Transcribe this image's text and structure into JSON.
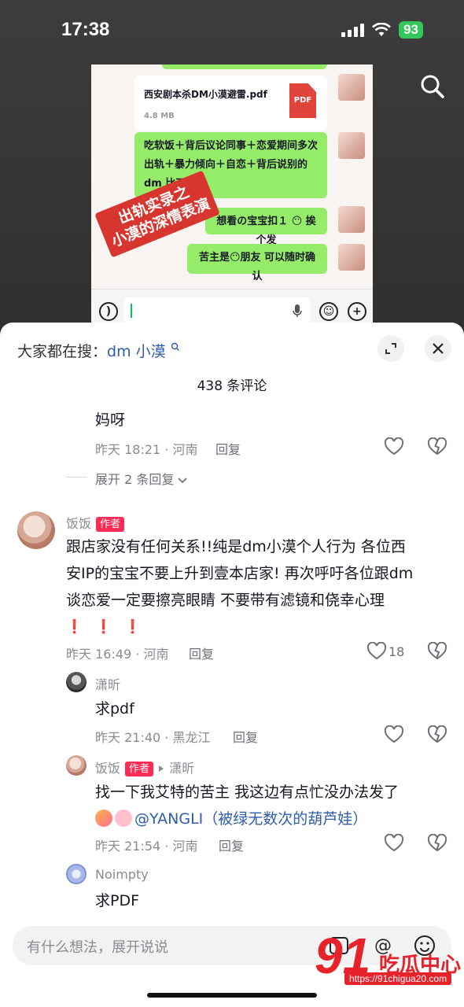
{
  "status_bar": {
    "time": "17:38",
    "battery": "93"
  },
  "preview": {
    "file_name": "西安剧本杀DM小漠避雷.pdf",
    "file_size": "4.8 MB",
    "file_type": "PDF",
    "messages": [
      "吃软饭＋背后议论同事＋恋爱期间多次出轨＋暴力倾向＋自恋＋背后说别的 dm 比不上他",
      "想看の宝宝扣１ 😶 挨个发",
      "苦主是😶朋友 可以随时确认"
    ],
    "stamp_lines": [
      "出轨实录之",
      "小漠的深情表演"
    ]
  },
  "sheet": {
    "search_prefix": "大家都在搜：",
    "search_keyword": "dm 小漠",
    "comment_count": "438 条评论"
  },
  "comments": {
    "top_reply": {
      "text": "妈呀",
      "meta": "昨天 18:21 · 河南",
      "reply_label": "回复"
    },
    "expand_label": "展开 2 条回复",
    "author_comment": {
      "name": "饭饭",
      "badge": "作者",
      "line1": "跟店家没有任何关系!!纯是dm小漠个人行为 各位西",
      "line2": "安IP的宝宝不要上升到壹本店家! 再次呼吁各位跟dm",
      "line3": "谈恋爱一定要擦亮眼睛 不要带有滤镜和侥幸心理",
      "exclaims": "❗❗❗",
      "meta": "昨天 16:49 · 河南",
      "reply_label": "回复",
      "likes": "18"
    },
    "reply1": {
      "name": "潇昕",
      "text": "求pdf",
      "meta": "昨天 21:40 · 黑龙江",
      "reply_label": "回复"
    },
    "reply2": {
      "name": "饭饭",
      "badge": "作者",
      "target": "潇昕",
      "text": "找一下我艾特的苦主 我这边有点忙没办法发了",
      "mention": "@YANGLI（被绿无数次的葫芦娃）",
      "meta": "昨天 21:54 · 河南",
      "reply_label": "回复"
    },
    "reply3": {
      "name": "Noimpty",
      "text": "求PDF"
    }
  },
  "bottom": {
    "placeholder": "有什么想法，展开说说"
  },
  "watermark": {
    "number": "91",
    "text": "吃瓜中心",
    "url": "https://91chigua20.com"
  },
  "colors": {
    "accent": "#fe2c55",
    "link": "#2f5cad",
    "wechat_green": "#95ec69"
  }
}
